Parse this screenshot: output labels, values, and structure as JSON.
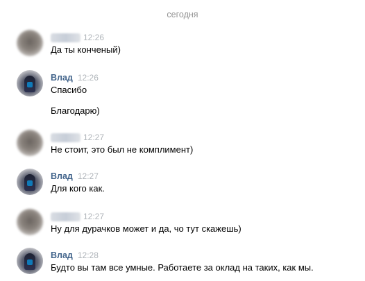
{
  "date_separator": "сегодня",
  "messages": [
    {
      "author": "",
      "author_hidden": true,
      "time": "12:26",
      "lines": [
        "Да ты конченый)"
      ]
    },
    {
      "author": "Влад",
      "author_hidden": false,
      "time": "12:26",
      "lines": [
        "Спасибо",
        "Благодарю)"
      ]
    },
    {
      "author": "",
      "author_hidden": true,
      "time": "12:27",
      "lines": [
        "Не стоит, это был не комплимент)"
      ]
    },
    {
      "author": "Влад",
      "author_hidden": false,
      "time": "12:27",
      "lines": [
        "Для кого как."
      ]
    },
    {
      "author": "",
      "author_hidden": true,
      "time": "12:27",
      "lines": [
        "Ну для дурачков может и да, чо тут скажешь)"
      ]
    },
    {
      "author": "Влад",
      "author_hidden": false,
      "time": "12:28",
      "lines": [
        "Будто вы там все умные. Работаете за оклад на таких, как мы."
      ]
    }
  ]
}
